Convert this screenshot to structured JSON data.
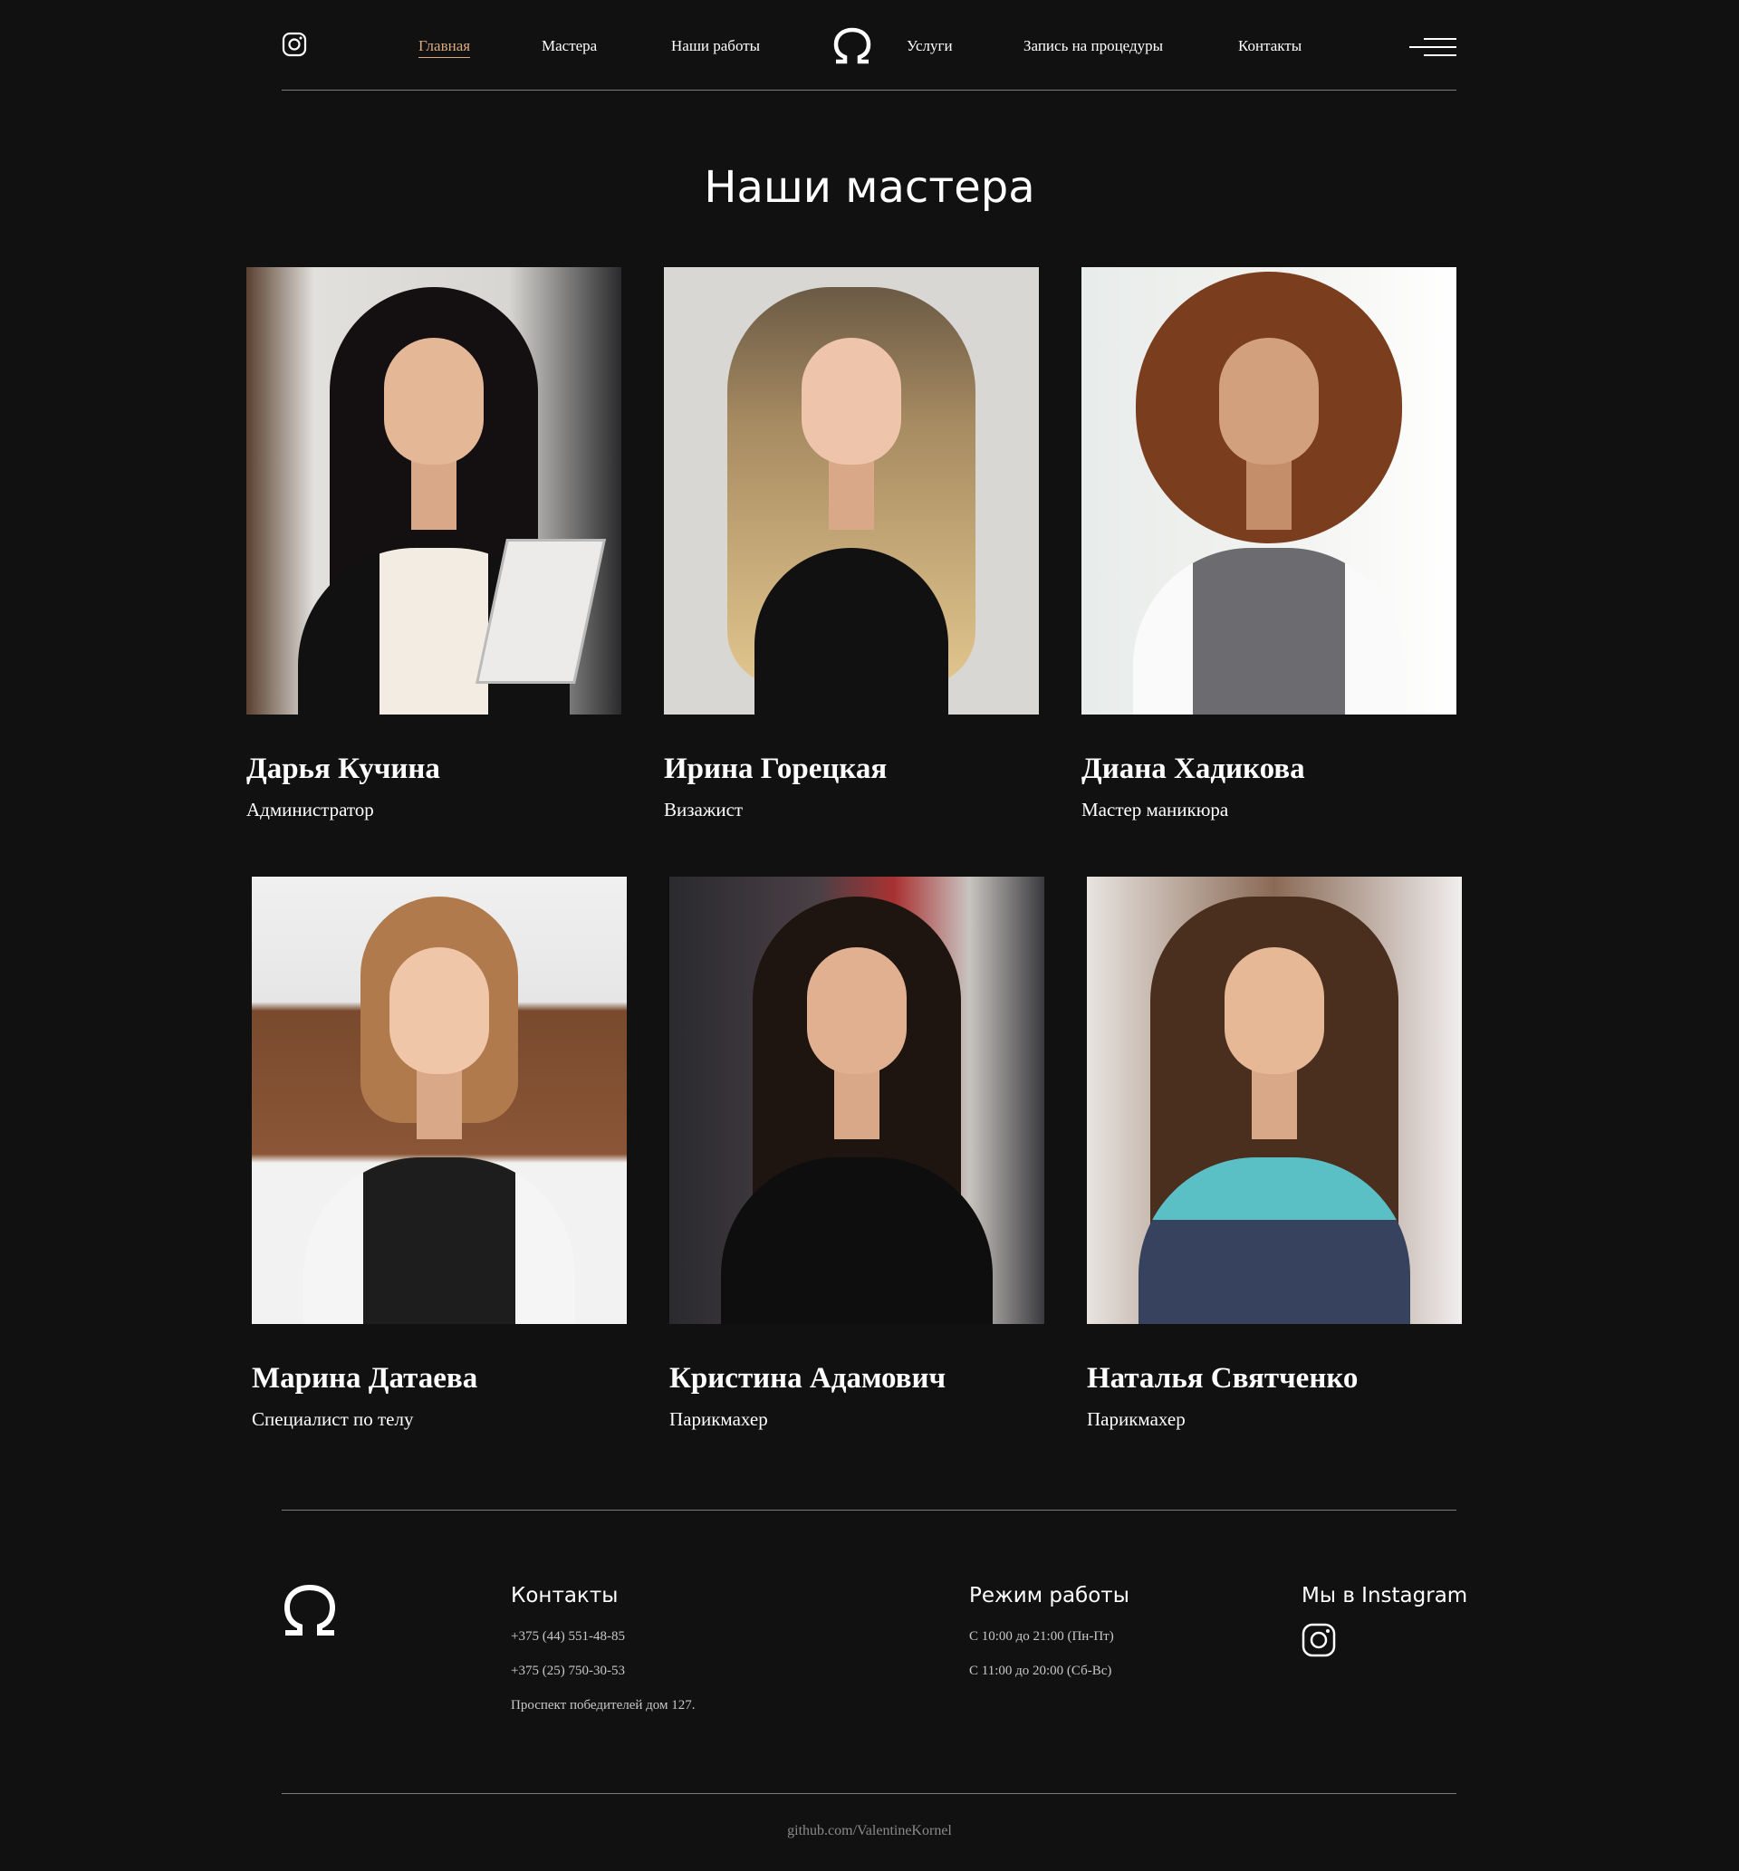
{
  "header": {
    "nav": [
      {
        "label": "Главная",
        "active": true
      },
      {
        "label": "Мастера"
      },
      {
        "label": "Наши работы"
      },
      {
        "label": "Услуги"
      },
      {
        "label": "Запись на процедуры"
      },
      {
        "label": "Контакты"
      }
    ],
    "icons": {
      "instagram": "instagram-icon",
      "logo": "omega-logo",
      "menu": "hamburger-menu-icon"
    },
    "accent_color": "#d7a97f"
  },
  "main": {
    "title": "Наши мастера",
    "masters": [
      {
        "name": "Дарья Кучина",
        "role": "Администратор"
      },
      {
        "name": "Ирина Горецкая",
        "role": "Визажист"
      },
      {
        "name": "Диана Хадикова",
        "role": "Мастер маникюра"
      },
      {
        "name": "Марина Датаева",
        "role": "Специалист по телу"
      },
      {
        "name": "Кристина Адамович",
        "role": "Парикмахер"
      },
      {
        "name": "Наталья Святченко",
        "role": "Парикмахер"
      }
    ]
  },
  "footer": {
    "contacts": {
      "title": "Контакты",
      "phone1": "+375 (44) 551-48-85",
      "phone2": "+375 (25) 750-30-53",
      "address": "Проспект победителей дом 127."
    },
    "hours": {
      "title": "Режим работы",
      "weekdays": "С 10:00 до 21:00 (Пн-Пт)",
      "weekend": "С 11:00 до 20:00 (Сб-Вс)"
    },
    "instagram": {
      "title": "Мы в Instagram"
    },
    "copyright": "github.com/ValentineKornel"
  },
  "colors": {
    "background": "#121112",
    "text": "#ffffff",
    "divider": "#7a7a7a"
  }
}
